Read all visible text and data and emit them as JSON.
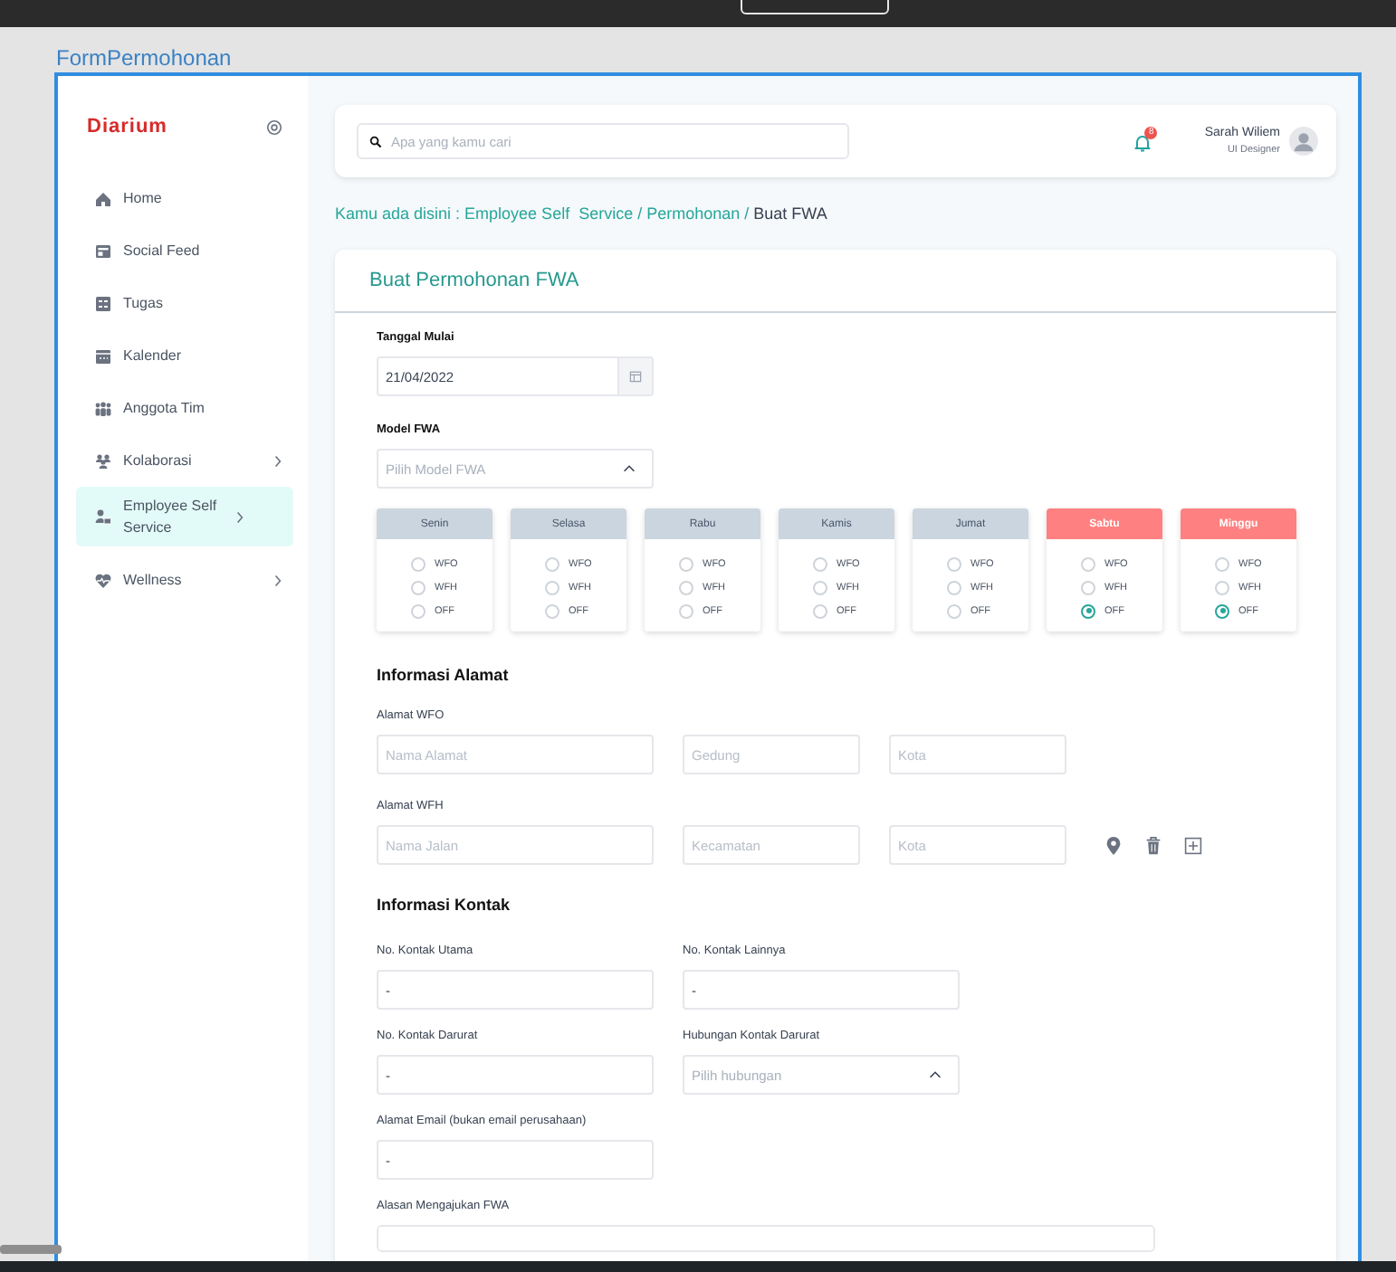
{
  "canvas_title": "FormPermohonan",
  "sidebar": {
    "logo": "Diarium",
    "items": [
      {
        "label": "Home",
        "selected": false,
        "expandable": false
      },
      {
        "label": "Social Feed",
        "selected": false,
        "expandable": false
      },
      {
        "label": "Tugas",
        "selected": false,
        "expandable": false
      },
      {
        "label": "Kalender",
        "selected": false,
        "expandable": false
      },
      {
        "label": "Anggota Tim",
        "selected": false,
        "expandable": false
      },
      {
        "label": "Kolaborasi",
        "selected": false,
        "expandable": true
      },
      {
        "label": "Employee Self Service",
        "selected": true,
        "expandable": true
      },
      {
        "label": "Wellness",
        "selected": false,
        "expandable": true
      }
    ]
  },
  "topbar": {
    "search": {
      "placeholder": "Apa yang kamu cari"
    },
    "notification_count": "8",
    "user": {
      "name": "Sarah Wiliem",
      "role": "UI Designer"
    }
  },
  "breadcrumb": {
    "trail": "Kamu ada disini : Employee Self  Service / Permohonan /",
    "current": "Buat FWA"
  },
  "form": {
    "title": "Buat Permohonan FWA",
    "start_date": {
      "label": "Tanggal Mulai",
      "value": "21/04/2022"
    },
    "model": {
      "label": "Model  FWA",
      "placeholder": "Pilih Model FWA"
    },
    "days": [
      {
        "name": "Senin",
        "weekend": false,
        "options": [
          {
            "label": "WFO",
            "selected": false
          },
          {
            "label": "WFH",
            "selected": false
          },
          {
            "label": "OFF",
            "selected": false
          }
        ]
      },
      {
        "name": "Selasa",
        "weekend": false,
        "options": [
          {
            "label": "WFO",
            "selected": false
          },
          {
            "label": "WFH",
            "selected": false
          },
          {
            "label": "OFF",
            "selected": false
          }
        ]
      },
      {
        "name": "Rabu",
        "weekend": false,
        "options": [
          {
            "label": "WFO",
            "selected": false
          },
          {
            "label": "WFH",
            "selected": false
          },
          {
            "label": "OFF",
            "selected": false
          }
        ]
      },
      {
        "name": "Kamis",
        "weekend": false,
        "options": [
          {
            "label": "WFO",
            "selected": false
          },
          {
            "label": "WFH",
            "selected": false
          },
          {
            "label": "OFF",
            "selected": false
          }
        ]
      },
      {
        "name": "Jumat",
        "weekend": false,
        "options": [
          {
            "label": "WFO",
            "selected": false
          },
          {
            "label": "WFH",
            "selected": false
          },
          {
            "label": "OFF",
            "selected": false
          }
        ]
      },
      {
        "name": "Sabtu",
        "weekend": true,
        "options": [
          {
            "label": "WFO",
            "selected": false
          },
          {
            "label": "WFH",
            "selected": false
          },
          {
            "label": "OFF",
            "selected": true
          }
        ]
      },
      {
        "name": "Minggu",
        "weekend": true,
        "options": [
          {
            "label": "WFO",
            "selected": false
          },
          {
            "label": "WFH",
            "selected": false
          },
          {
            "label": "OFF",
            "selected": true
          }
        ]
      }
    ],
    "address": {
      "title": "Informasi Alamat",
      "groups": [
        {
          "label": "Alamat WFO",
          "has_actions": false,
          "fields": [
            {
              "placeholder": "Nama Alamat"
            },
            {
              "placeholder": "Gedung"
            },
            {
              "placeholder": "Kota"
            }
          ]
        },
        {
          "label": "Alamat WFH",
          "has_actions": true,
          "fields": [
            {
              "placeholder": "Nama Jalan"
            },
            {
              "placeholder": "Kecamatan"
            },
            {
              "placeholder": "Kota"
            }
          ]
        }
      ]
    },
    "contact": {
      "title": "Informasi Kontak",
      "fields": [
        {
          "kind": "text",
          "label": "No. Kontak Utama",
          "value": "-"
        },
        {
          "kind": "text",
          "label": "No. Kontak Lainnya",
          "value": "-"
        },
        {
          "kind": "text",
          "label": "No. Kontak Darurat",
          "value": "-"
        },
        {
          "kind": "select",
          "label": "Hubungan Kontak Darurat",
          "placeholder": "Pilih hubungan"
        },
        {
          "kind": "text",
          "label": "Alamat Email (bukan email perusahaan)",
          "value": "-"
        },
        {
          "kind": "textarea",
          "label": "Alasan Mengajukan FWA"
        }
      ]
    }
  }
}
